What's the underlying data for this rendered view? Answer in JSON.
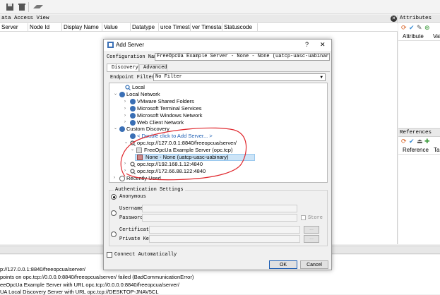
{
  "main": {
    "data_access_title": "ata Access View",
    "columns": [
      "Server",
      "Node Id",
      "Display Name",
      "Value",
      "Datatype",
      "urce Timesta",
      "ver Timestar",
      "Statuscode"
    ]
  },
  "right": {
    "attributes_title": "Attributes",
    "attributes_header": [
      "Attribute",
      "Val"
    ],
    "references_title": "References",
    "references_header": [
      "Reference",
      "Ta"
    ]
  },
  "log": [
    "p://127.0.0.1:8840/freeopcua/server/",
    "points on opc.tcp://0.0.0.0:8840/freeopcua/server/ failed (BadCommunicationError)",
    "eeOpcUa Example Server with URL opc.tcp://0.0.0.0:8840/freeopcua/server/",
    " UA Local Discovery Server with URL opc.tcp://DESKTOP-JNAV5CL"
  ],
  "dialog": {
    "title": "Add Server",
    "help": "?",
    "close": "✕",
    "config_label": "Configuration Name",
    "config_value": "FreeOpcUa Example Server - None - None (uatcp-uasc-uabinary)",
    "tabs": [
      "Discovery",
      "Advanced"
    ],
    "filter_label": "Endpoint Filter:",
    "filter_value": "No Filter",
    "tree": [
      {
        "label": "Local"
      },
      {
        "label": "Local Network"
      },
      {
        "label": "VMware Shared Folders"
      },
      {
        "label": "Microsoft Terminal Services"
      },
      {
        "label": "Microsoft Windows Network"
      },
      {
        "label": "Web Client Network"
      },
      {
        "label": "Custom Discovery"
      },
      {
        "label": "< Double click to Add Server... >"
      },
      {
        "label": "opc.tcp://127.0.0.1:8840/freeopcua/server/"
      },
      {
        "label": "FreeOpcUa Example Server (opc.tcp)"
      },
      {
        "label": "None - None (uatcp-uasc-uabinary)"
      },
      {
        "label": "opc.tcp://192.168.1.12:4840"
      },
      {
        "label": "opc.tcp://172.66.88.122:4840"
      },
      {
        "label": "Recently Used"
      }
    ],
    "auth_title": "Authentication Settings",
    "anonymous": "Anonymous",
    "username": "Username",
    "password": "Password",
    "store": "Store",
    "certificate": "Certificate",
    "private_key": "Private Key",
    "browse": "...",
    "connect_auto": "Connect Automatically",
    "ok": "OK",
    "cancel": "Cancel"
  },
  "colors": {
    "accent": "#1e5fb4",
    "selection": "#cce4f7",
    "annotation": "#e0282e"
  }
}
